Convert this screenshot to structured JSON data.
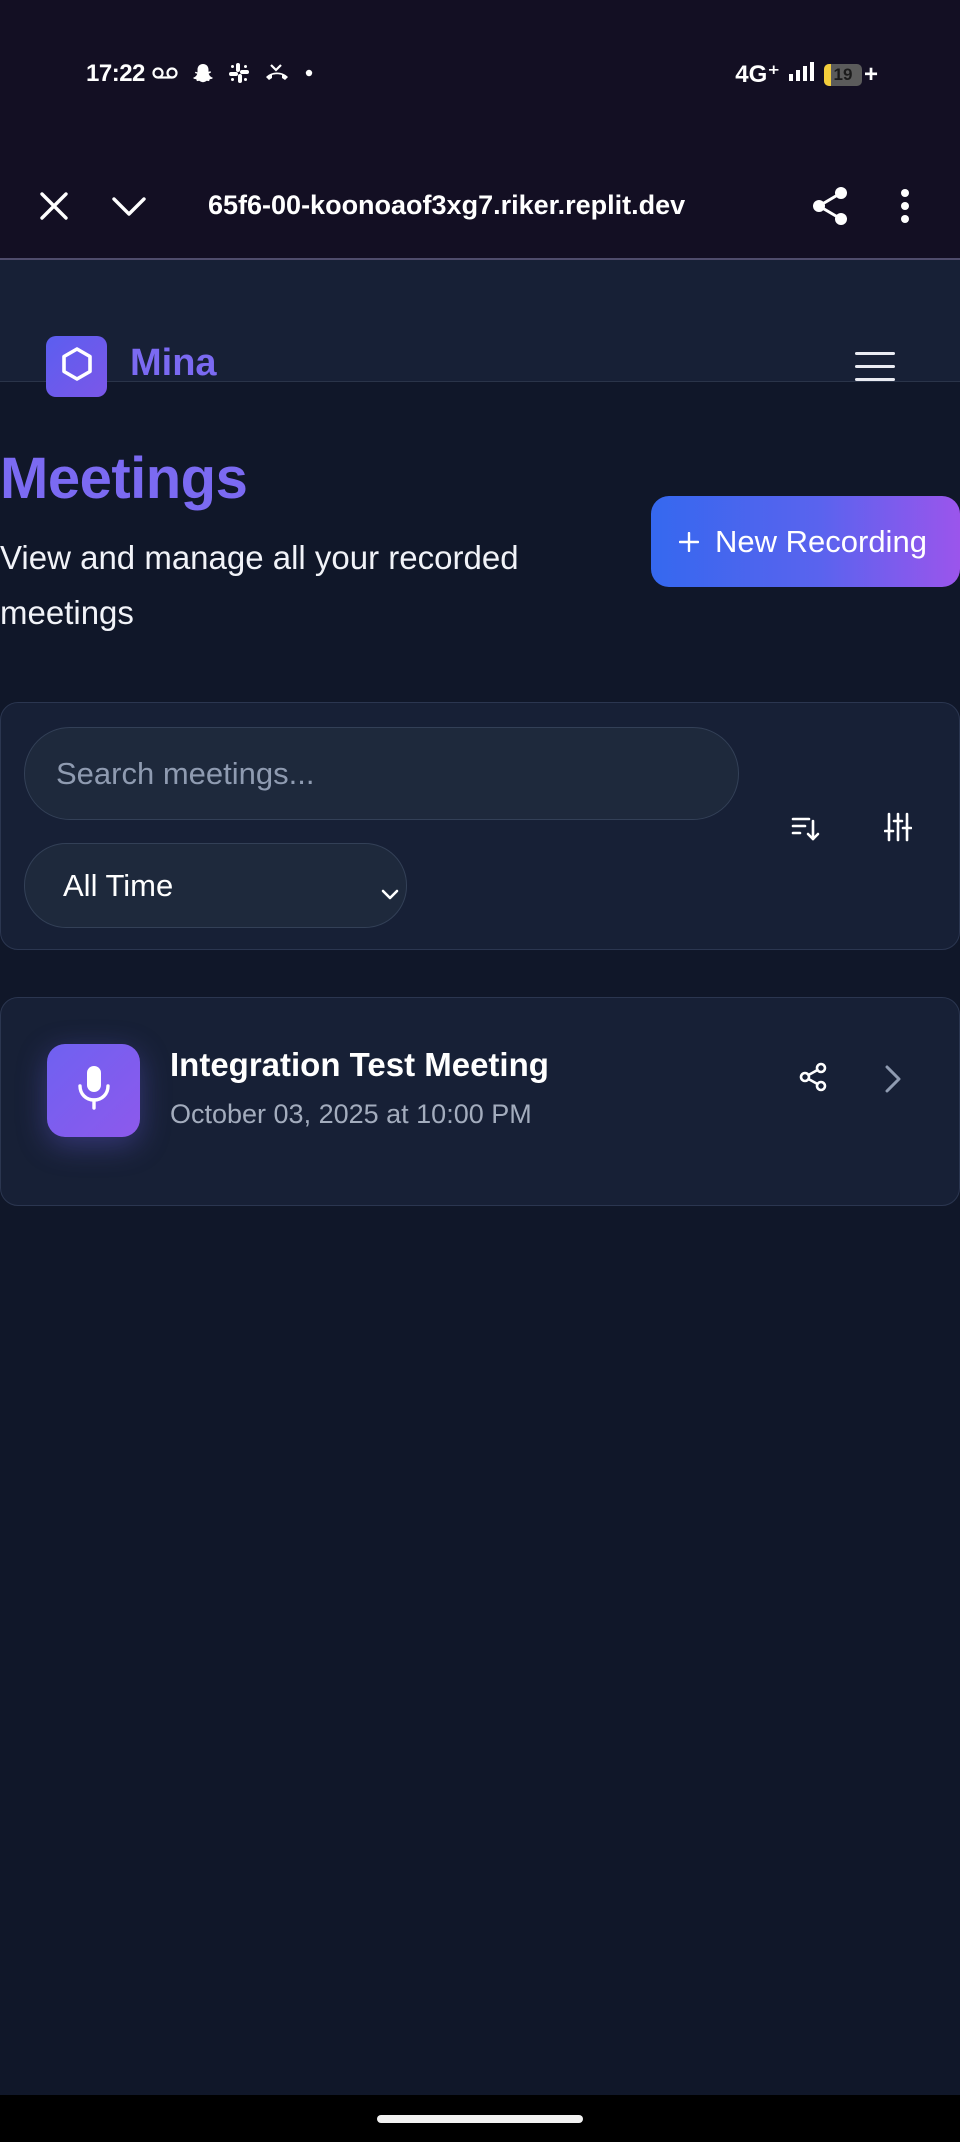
{
  "status_bar": {
    "time": "17:22",
    "network": "4G⁺",
    "battery_level": "19",
    "battery_fraction": 0.19,
    "charging_symbol": "+",
    "icons": [
      "voicemail-icon",
      "snapchat-icon",
      "slack-icon",
      "missed-call-icon",
      "dot-icon"
    ]
  },
  "browser": {
    "url": "65f6-00-koonoaof3xg7.riker.replit.dev",
    "icons": [
      "close-icon",
      "chevron-down-icon",
      "share-icon",
      "more-vert-icon"
    ]
  },
  "header": {
    "brand": "Mina",
    "logo_icon": "hexagon-icon",
    "menu_icon": "hamburger-icon"
  },
  "page": {
    "title": "Meetings",
    "subtitle": "View and manage all your recorded meetings",
    "new_recording_label": "New Recording",
    "new_recording_icon": "plus-icon"
  },
  "filters": {
    "search_placeholder": "Search meetings...",
    "time_range": "All Time",
    "sort_icon": "sort-icon",
    "filter_icon": "sliders-icon"
  },
  "meetings": [
    {
      "title": "Integration Test Meeting",
      "date": "October 03, 2025 at 10:00 PM",
      "icon": "mic-icon"
    }
  ],
  "colors": {
    "background": "#101729",
    "card": "#172036",
    "accent": "#7b6af2",
    "button_gradient_start": "#3568ef",
    "button_gradient_end": "#9b55ec"
  }
}
